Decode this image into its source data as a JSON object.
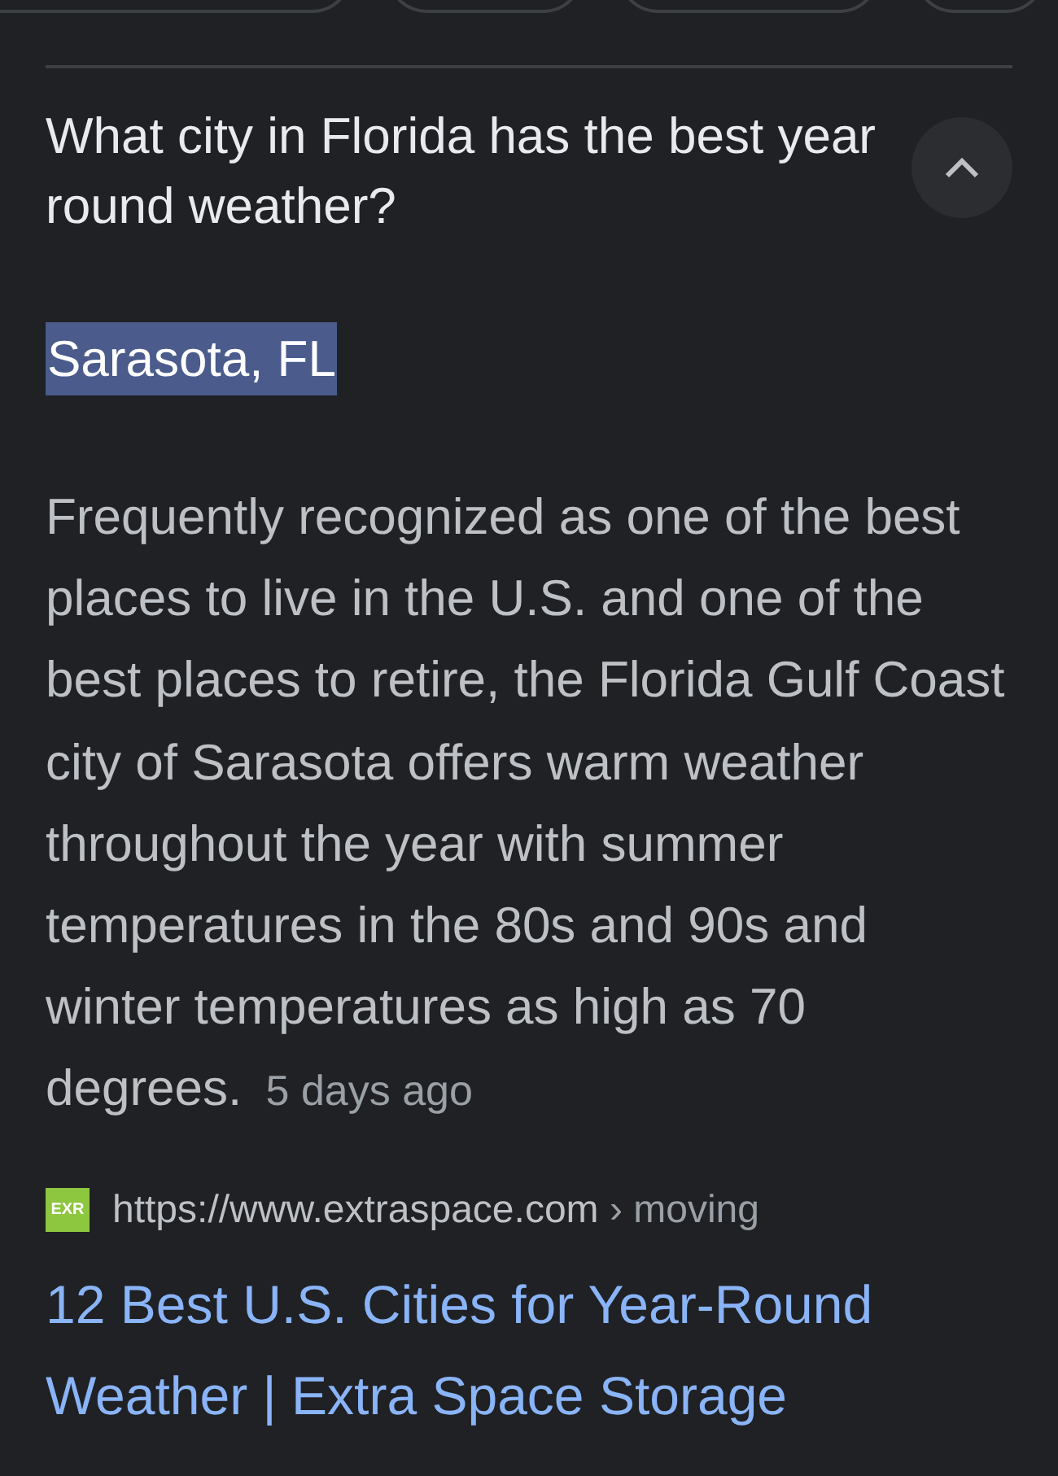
{
  "question": {
    "text": "What city in Florida has the best year round weather?",
    "expanded": true
  },
  "answer": {
    "text": "Sarasota, FL",
    "selected": true
  },
  "snippet": {
    "text": "Frequently recognized as one of the best places to live in the U.S. and one of the best places to retire, the Florida Gulf Coast city of Sarasota offers warm weather throughout the year with summer temperatures in the 80s and 90s and winter temperatures as high as 70 degrees.",
    "date": "5 days ago"
  },
  "source": {
    "favicon": "EXR",
    "url": "https://www.extraspace.com",
    "path": "› moving",
    "title": "12 Best U.S. Cities for Year-Round Weather | Extra Space Storage"
  }
}
